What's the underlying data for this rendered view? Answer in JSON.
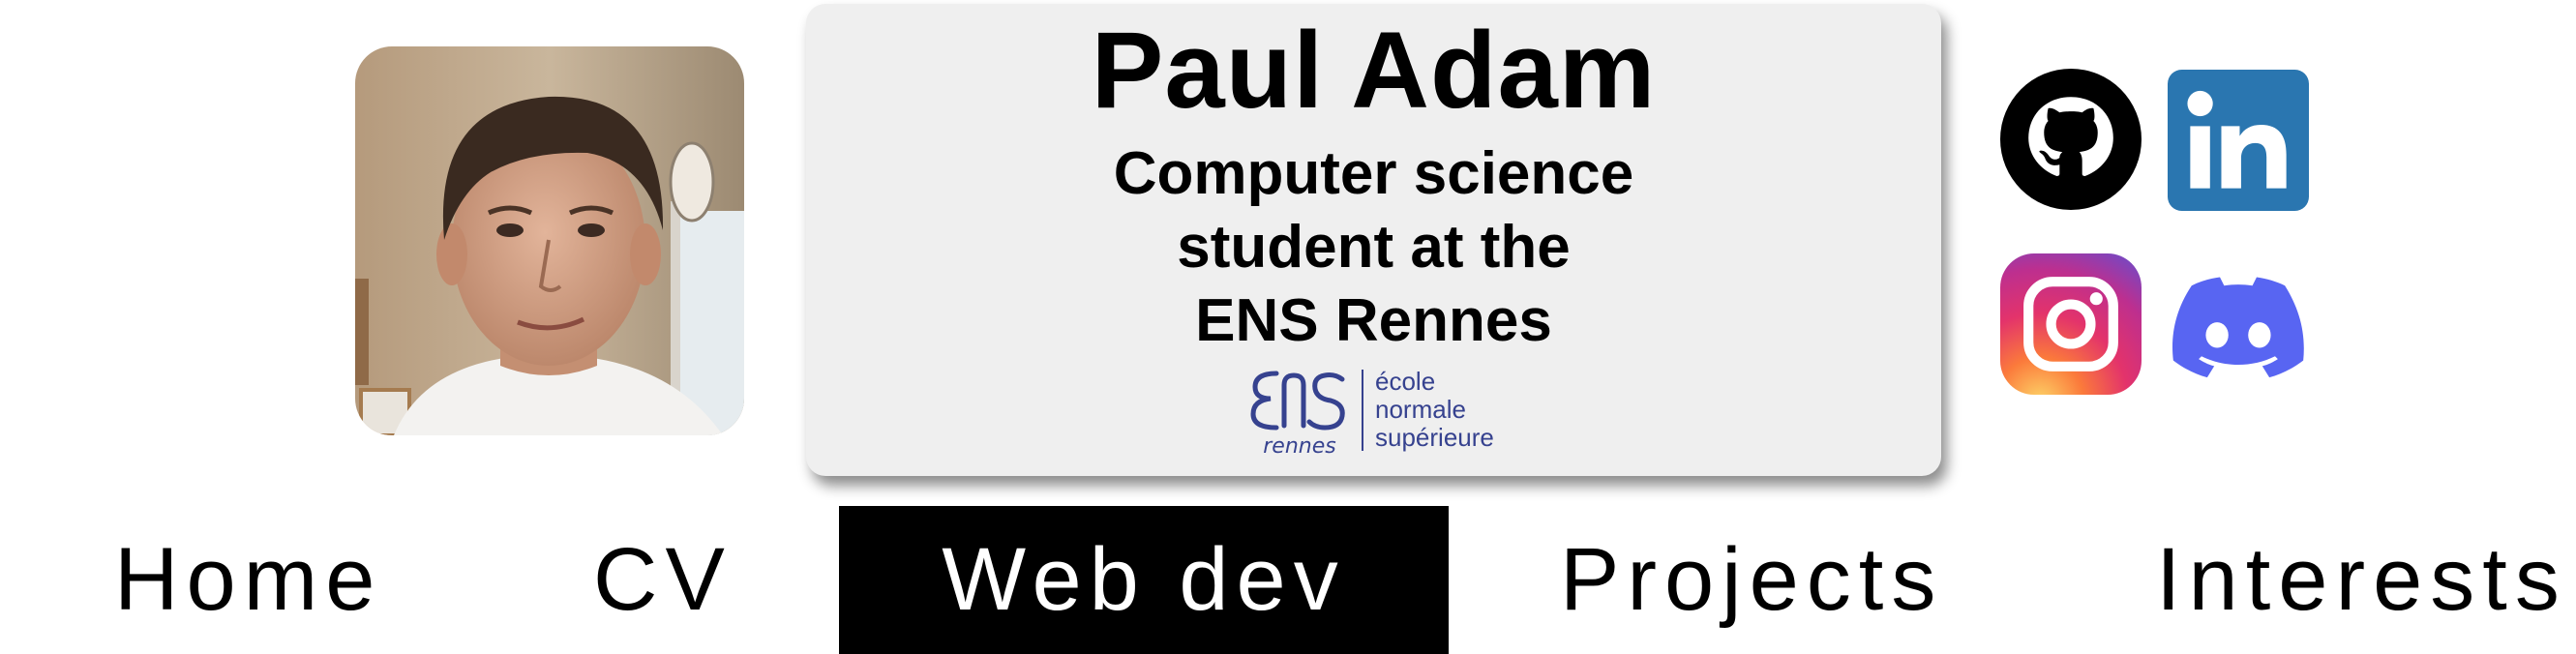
{
  "header": {
    "name": "Paul Adam",
    "subtitle_lines": [
      "Computer science",
      "student at the",
      "ENS Rennes"
    ],
    "school_logo": {
      "mark_text": "rennes",
      "text_lines": [
        "école",
        "normale",
        "supérieure"
      ],
      "color": "#36428f"
    }
  },
  "profile_photo": {
    "icon": "profile-photo"
  },
  "social": [
    {
      "name": "github",
      "icon": "github-icon",
      "color": "#000000"
    },
    {
      "name": "linkedin",
      "icon": "linkedin-icon",
      "color": "#2a76b0"
    },
    {
      "name": "instagram",
      "icon": "instagram-icon",
      "color": "#d6317a"
    },
    {
      "name": "discord",
      "icon": "discord-icon",
      "color": "#5865f2"
    }
  ],
  "nav": {
    "items": [
      {
        "label": "Home",
        "active": false
      },
      {
        "label": "CV",
        "active": false
      },
      {
        "label": "Web dev",
        "active": true
      },
      {
        "label": "Projects",
        "active": false
      },
      {
        "label": "Interests",
        "active": false
      }
    ]
  }
}
